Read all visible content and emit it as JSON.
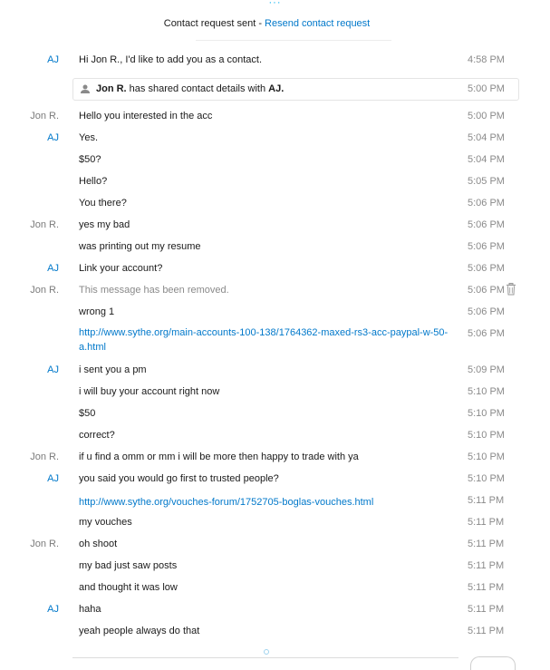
{
  "header": {
    "status_text": "Contact request sent",
    "separator": " - ",
    "resend_link": "Resend contact request"
  },
  "shared_contact": {
    "sender": "Jon R.",
    "middle": " has shared contact details with ",
    "recipient": "AJ.",
    "time": "5:00 PM"
  },
  "messages": [
    {
      "sender": "AJ",
      "text": "Hi Jon R., I'd like to add you as a contact.",
      "time": "4:58 PM"
    },
    {
      "sender": "Jon R.",
      "text": "Hello you interested in the acc",
      "time": "5:00 PM"
    },
    {
      "sender": "AJ",
      "text": "Yes.",
      "time": "5:04 PM"
    },
    {
      "sender": "",
      "text": "$50?",
      "time": "5:04 PM"
    },
    {
      "sender": "",
      "text": "Hello?",
      "time": "5:05 PM"
    },
    {
      "sender": "",
      "text": "You there?",
      "time": "5:06 PM"
    },
    {
      "sender": "Jon R.",
      "text": "yes my bad",
      "time": "5:06 PM"
    },
    {
      "sender": "",
      "text": "was printing out my resume",
      "time": "5:06 PM"
    },
    {
      "sender": "AJ",
      "text": "Link your account?",
      "time": "5:06 PM"
    },
    {
      "sender": "Jon R.",
      "text": "This message has been removed.",
      "time": "5:06 PM"
    },
    {
      "sender": "",
      "text": "wrong 1",
      "time": "5:06 PM"
    },
    {
      "sender": "",
      "text": "http://www.sythe.org/main-accounts-100-138/1764362-maxed-rs3-acc-paypal-w-50-a.html",
      "time": "5:06 PM"
    },
    {
      "sender": "AJ",
      "text": "i sent you a pm",
      "time": "5:09 PM"
    },
    {
      "sender": "",
      "text": "i will buy your account right now",
      "time": "5:10 PM"
    },
    {
      "sender": "",
      "text": "$50",
      "time": "5:10 PM"
    },
    {
      "sender": "",
      "text": "correct?",
      "time": "5:10 PM"
    },
    {
      "sender": "Jon R.",
      "text": "if u find a omm or mm i will be more then happy to trade with ya",
      "time": "5:10 PM"
    },
    {
      "sender": "AJ",
      "text": "you said you would go first to trusted people?",
      "time": "5:10 PM"
    },
    {
      "sender": "",
      "text": "http://www.sythe.org/vouches-forum/1752705-boglas-vouches.html",
      "time": "5:11 PM"
    },
    {
      "sender": "",
      "text": "my vouches",
      "time": "5:11 PM"
    },
    {
      "sender": "Jon R.",
      "text": "oh shoot",
      "time": "5:11 PM"
    },
    {
      "sender": "",
      "text": "my bad just saw posts",
      "time": "5:11 PM"
    },
    {
      "sender": "",
      "text": "and thought it was low",
      "time": "5:11 PM"
    },
    {
      "sender": "AJ",
      "text": "haha",
      "time": "5:11 PM"
    },
    {
      "sender": "",
      "text": "yeah people always do that",
      "time": "5:11 PM"
    }
  ]
}
